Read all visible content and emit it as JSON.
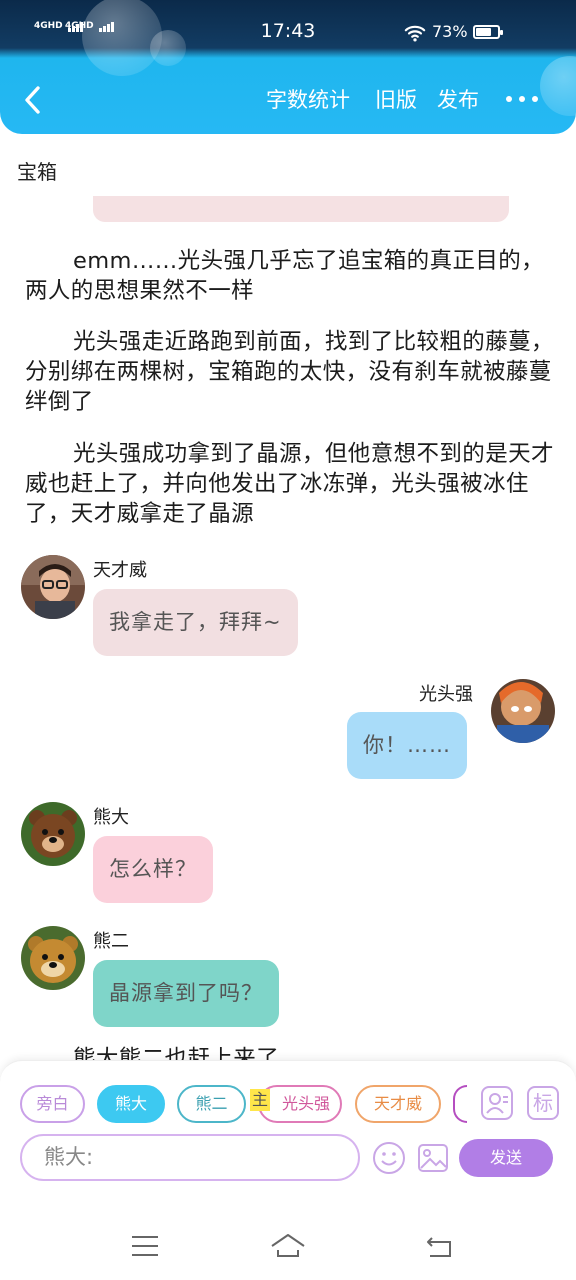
{
  "status_bar": {
    "signal_1": "4GHD",
    "signal_2": "4GHD",
    "time": "17:43",
    "battery_percent": "73%",
    "battery_level": 0.73
  },
  "toolbar": {
    "back_icon": "chevron-left-icon",
    "word_count_label": "字数统计",
    "old_version_label": "旧版",
    "publish_label": "发布",
    "more_icon": "more-dots-icon"
  },
  "work_title": "宝箱",
  "narration": [
    "emm……光头强几乎忘了追宝箱的真正目的，两人的思想果然不一样",
    "光头强走近路跑到前面，找到了比较粗的藤蔓，分别绑在两棵树，宝箱跑的太快，没有刹车就被藤蔓绊倒了",
    "光头强成功拿到了晶源，但他意想不到的是天才威也赶上了，并向他发出了冰冻弹，光头强被冰住了，天才威拿走了晶源"
  ],
  "messages": [
    {
      "speaker": "天才威",
      "text": "我拿走了，拜拜~",
      "side": "left",
      "color": "#f2dfe1"
    },
    {
      "speaker": "光头强",
      "text": "你！……",
      "side": "right",
      "color": "#a9dcf9"
    },
    {
      "speaker": "熊大",
      "text": "怎么样？",
      "side": "left",
      "color": "#fbd0db"
    },
    {
      "speaker": "熊二",
      "text": "晶源拿到了吗？",
      "side": "left",
      "color": "#7fd5c9"
    }
  ],
  "partial_narration": "熊大熊二也赶上来了",
  "role_chips": [
    {
      "label": "旁白",
      "color": "#c9a0e8",
      "text_color": "#b98ad8"
    },
    {
      "label": "熊大",
      "color": "#3dc9f1",
      "text_color": "#ffffff",
      "active": true
    },
    {
      "label": "熊二",
      "color": "#4cb6c9",
      "text_color": "#3a9fb0"
    },
    {
      "label": "光头强",
      "color": "#e07ab7",
      "text_color": "#d0579b"
    },
    {
      "label": "天才威",
      "color": "#f0a56a",
      "text_color": "#e88c45"
    }
  ],
  "host_badge": "主",
  "panel_icons": {
    "contact": "contact-card-icon",
    "mark": "标"
  },
  "input": {
    "value": "熊大:"
  },
  "send_label": "发送",
  "nav_icons": [
    "menu-icon",
    "home-icon",
    "back-icon"
  ]
}
